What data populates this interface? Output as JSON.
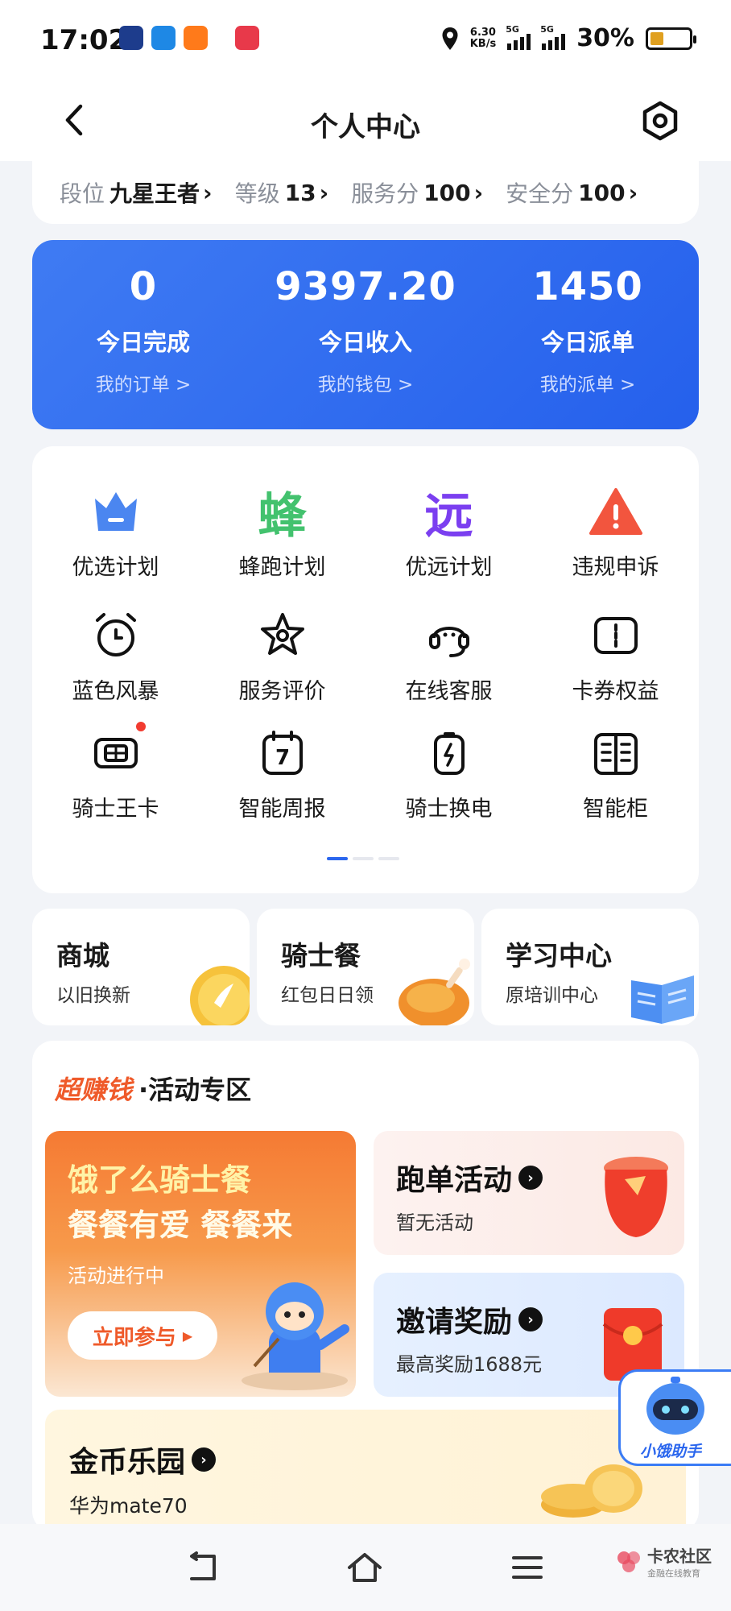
{
  "status_bar": {
    "time": "17:02",
    "net_speed_value": "6.30",
    "net_speed_unit": "KB/s",
    "signal_1": "5G",
    "signal_2": "5G",
    "battery": "30%"
  },
  "header": {
    "title": "个人中心",
    "back_icon": "chevron-left-icon",
    "settings_icon": "hexagon-gear-icon"
  },
  "rank_bar": [
    {
      "label": "段位",
      "value": "九星王者"
    },
    {
      "label": "等级",
      "value": "13"
    },
    {
      "label": "服务分",
      "value": "100"
    },
    {
      "label": "安全分",
      "value": "100"
    }
  ],
  "stats": [
    {
      "value": "0",
      "label": "今日完成",
      "link": "我的订单 >"
    },
    {
      "value": "9397.20",
      "label": "今日收入",
      "link": "我的钱包 >"
    },
    {
      "value": "1450",
      "label": "今日派单",
      "link": "我的派单 >"
    }
  ],
  "services": [
    {
      "label": "优选计划",
      "icon": "crown-icon"
    },
    {
      "label": "蜂跑计划",
      "icon": "feng-character-icon",
      "glyph": "蜂"
    },
    {
      "label": "优远计划",
      "icon": "yuan-character-icon",
      "glyph": "远"
    },
    {
      "label": "违规申诉",
      "icon": "warning-icon",
      "glyph": "!"
    },
    {
      "label": "蓝色风暴",
      "icon": "alarm-clock-icon"
    },
    {
      "label": "服务评价",
      "icon": "star-icon"
    },
    {
      "label": "在线客服",
      "icon": "headset-icon"
    },
    {
      "label": "卡券权益",
      "icon": "ticket-icon"
    },
    {
      "label": "骑士王卡",
      "icon": "card-icon",
      "badge": true
    },
    {
      "label": "智能周报",
      "icon": "calendar-icon",
      "glyph": "7"
    },
    {
      "label": "骑士换电",
      "icon": "battery-swap-icon"
    },
    {
      "label": "智能柜",
      "icon": "locker-icon"
    }
  ],
  "promos": [
    {
      "title": "商城",
      "subtitle": "以旧换新",
      "icon": "gold-coin-icon"
    },
    {
      "title": "骑士餐",
      "subtitle": "红包日日领",
      "icon": "roast-chicken-icon"
    },
    {
      "title": "学习中心",
      "subtitle": "原培训中心",
      "icon": "book-icon"
    }
  ],
  "activity": {
    "brand": "超赚钱",
    "title": "·活动专区",
    "banner": {
      "line1": "饿了么骑士餐",
      "line2": "餐餐有爱 餐餐来",
      "status": "活动进行中",
      "button": "立即参与",
      "icon": "rider-mascot-icon"
    },
    "run_activity": {
      "title": "跑单活动",
      "subtitle": "暂无活动",
      "icon": "red-pot-icon"
    },
    "invite": {
      "title": "邀请奖励",
      "subtitle": "最高奖励1688元",
      "icon": "red-envelope-icon"
    },
    "coin_park": {
      "title": "金币乐园",
      "subtitle": "华为mate70",
      "icon": "coin-stack-icon"
    }
  },
  "assistant": {
    "label": "小饿助手",
    "icon": "robot-mascot-icon"
  },
  "bottom_nav": [
    {
      "name": "back",
      "icon": "nav-back-icon"
    },
    {
      "name": "home",
      "icon": "nav-home-icon"
    },
    {
      "name": "menu",
      "icon": "nav-menu-icon"
    }
  ],
  "watermark": {
    "title": "卡农社区",
    "subtitle": "金融在线教育"
  },
  "colors": {
    "accent_blue": "#2a66ee",
    "orange": "#ef5a2a",
    "badge_red": "#f23b30"
  }
}
